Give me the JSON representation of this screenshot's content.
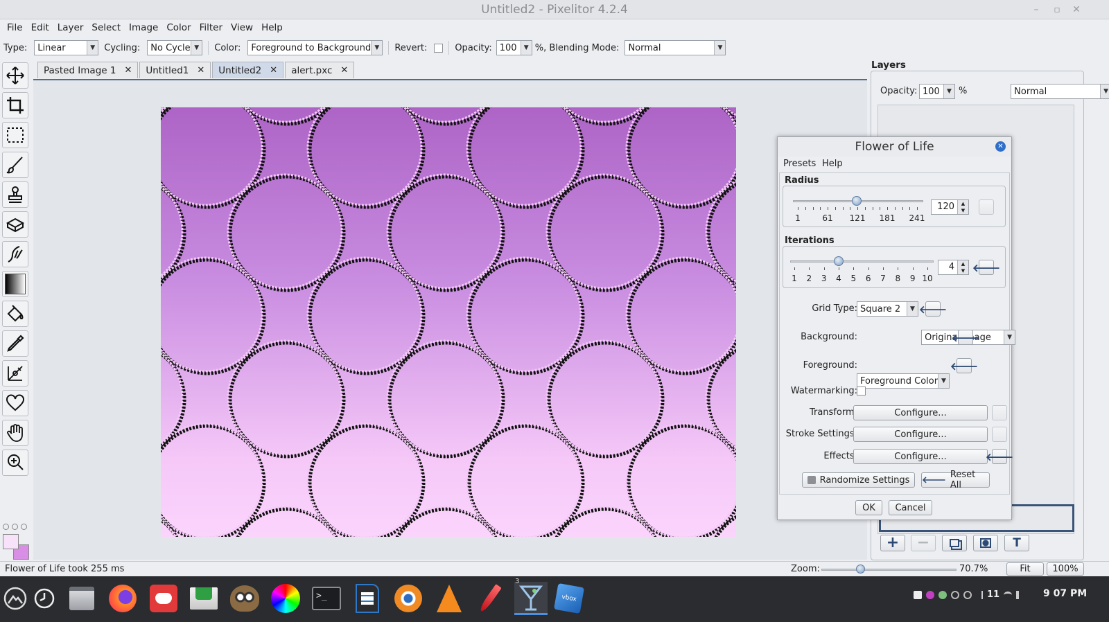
{
  "window": {
    "title": "Untitled2 - Pixelitor 4.2.4"
  },
  "menu": [
    "File",
    "Edit",
    "Layer",
    "Select",
    "Image",
    "Color",
    "Filter",
    "View",
    "Help"
  ],
  "options": {
    "type_label": "Type:",
    "type_value": "Linear",
    "cycling_label": "Cycling:",
    "cycling_value": "No Cycle",
    "color_label": "Color:",
    "color_value": "Foreground to Background",
    "revert_label": "Revert:",
    "opacity_label": "Opacity:",
    "opacity_value": "100",
    "blend_label": "%, Blending Mode:",
    "blend_value": "Normal"
  },
  "tabs": [
    {
      "label": "Pasted Image 1",
      "active": false
    },
    {
      "label": "Untitled1",
      "active": false
    },
    {
      "label": "Untitled2",
      "active": true
    },
    {
      "label": "alert.pxc",
      "active": false
    }
  ],
  "tools": [
    "move-icon",
    "crop-icon",
    "selection-icon",
    "brush-icon",
    "clone-stamp-icon",
    "eraser-icon",
    "smudge-icon",
    "gradient-icon",
    "paint-bucket-icon",
    "color-picker-icon",
    "pen-icon",
    "shapes-icon",
    "hand-icon",
    "zoom-icon"
  ],
  "colors": {
    "foreground": "#f8e2fa",
    "background": "#d98ee6",
    "accent": "#566a86"
  },
  "layers": {
    "title": "Layers",
    "opacity_label": "Opacity:",
    "opacity_value": "100",
    "percent": "%",
    "blend_value": "Normal"
  },
  "dialog": {
    "title": "Flower of Life",
    "menu": [
      "Presets",
      "Help"
    ],
    "radius": {
      "label": "Radius",
      "value": "120",
      "min": 1,
      "max": 241,
      "current": 120,
      "ticks": [
        "1",
        "61",
        "121",
        "181",
        "241"
      ]
    },
    "iterations": {
      "label": "Iterations",
      "value": "4",
      "min": 1,
      "max": 10,
      "current": 4,
      "ticks": [
        "1",
        "2",
        "3",
        "4",
        "5",
        "6",
        "7",
        "8",
        "9",
        "10"
      ]
    },
    "grid_type": {
      "label": "Grid Type:",
      "value": "Square 2"
    },
    "background": {
      "label": "Background:",
      "value": "Original Image"
    },
    "foreground": {
      "label": "Foreground:",
      "value": "Foreground Color"
    },
    "watermarking": {
      "label": "Watermarking:"
    },
    "transform": {
      "label": "Transform:",
      "button": "Configure..."
    },
    "stroke": {
      "label": "Stroke Settings:",
      "button": "Configure..."
    },
    "effects": {
      "label": "Effects:",
      "button": "Configure..."
    },
    "randomize": "Randomize Settings",
    "reset": "Reset All",
    "ok": "OK",
    "cancel": "Cancel"
  },
  "status": {
    "message": "Flower of Life took 255 ms",
    "zoom_label": "Zoom:",
    "zoom_value": "70.7%",
    "fit": "Fit",
    "hundred": "100%"
  },
  "taskbar": {
    "apps": [
      "app-menu-icon",
      "clock-icon",
      "files-icon",
      "firefox-icon",
      "discord-icon",
      "mail-icon",
      "gimp-icon",
      "color-wheel-icon",
      "terminal-icon",
      "writer-icon",
      "blender-icon",
      "vlc-icon",
      "pen-app-icon",
      "cocktail-icon",
      "virtualbox-icon"
    ],
    "badge": "3",
    "tray_count": "11",
    "time": "9 07 PM"
  }
}
